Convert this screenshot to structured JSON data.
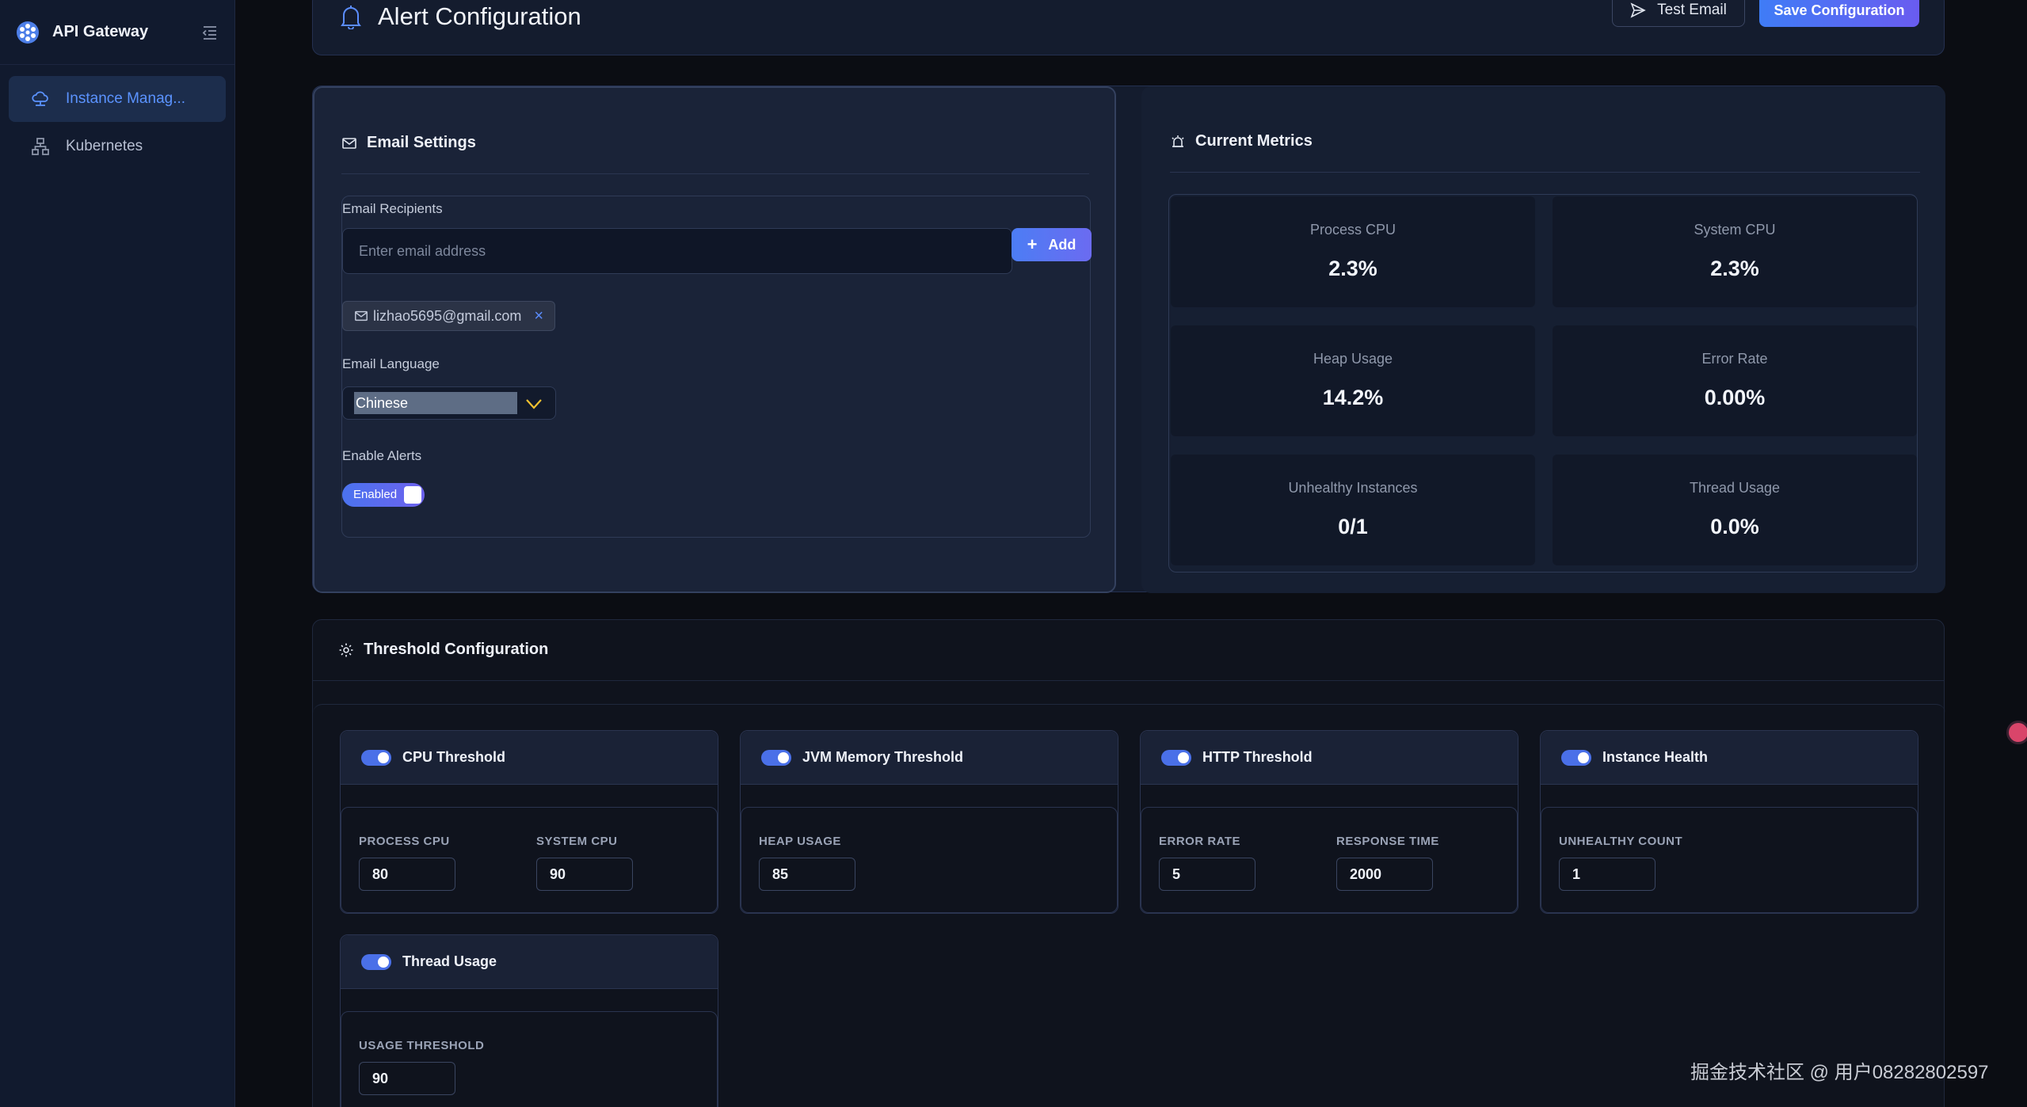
{
  "app": {
    "name": "API Gateway"
  },
  "sidebar": {
    "items": [
      {
        "label": "Instance Manag...",
        "icon": "cloud-network-icon",
        "active": true
      },
      {
        "label": "Kubernetes",
        "icon": "cluster-icon",
        "active": false
      }
    ]
  },
  "header": {
    "title": "Alert Configuration",
    "test_email_label": "Test Email",
    "save_label": "Save Configuration"
  },
  "email_settings": {
    "title": "Email Settings",
    "recipients_label": "Email Recipients",
    "input_placeholder": "Enter email address",
    "input_value": "",
    "add_label": "Add",
    "recipients": [
      "lizhao5695@gmail.com"
    ],
    "remove_symbol": "×",
    "language_label": "Email Language",
    "language_value": "Chinese",
    "alerts_label": "Enable Alerts",
    "alerts_toggle_text": "Enabled",
    "alerts_enabled": true
  },
  "metrics": {
    "title": "Current Metrics",
    "items": [
      {
        "label": "Process CPU",
        "value": "2.3%"
      },
      {
        "label": "System CPU",
        "value": "2.3%"
      },
      {
        "label": "Heap Usage",
        "value": "14.2%"
      },
      {
        "label": "Error Rate",
        "value": "0.00%"
      },
      {
        "label": "Unhealthy Instances",
        "value": "0/1"
      },
      {
        "label": "Thread Usage",
        "value": "0.0%"
      }
    ]
  },
  "thresholds": {
    "title": "Threshold Configuration",
    "cards": [
      {
        "title": "CPU Threshold",
        "enabled": true,
        "fields": [
          {
            "label": "PROCESS CPU",
            "value": "80"
          },
          {
            "label": "SYSTEM CPU",
            "value": "90"
          }
        ]
      },
      {
        "title": "JVM Memory Threshold",
        "enabled": true,
        "fields": [
          {
            "label": "HEAP USAGE",
            "value": "85"
          }
        ]
      },
      {
        "title": "HTTP Threshold",
        "enabled": true,
        "fields": [
          {
            "label": "ERROR RATE",
            "value": "5"
          },
          {
            "label": "RESPONSE TIME",
            "value": "2000"
          }
        ]
      },
      {
        "title": "Instance Health",
        "enabled": true,
        "fields": [
          {
            "label": "UNHEALTHY COUNT",
            "value": "1"
          }
        ]
      },
      {
        "title": "Thread Usage",
        "enabled": true,
        "fields": [
          {
            "label": "USAGE THRESHOLD",
            "value": "90"
          }
        ]
      }
    ]
  },
  "watermark": "掘金技术社区 @ 用户08282802597",
  "colors": {
    "accent": "#5b8dff",
    "primary_gradient_start": "#3f7cf6",
    "primary_gradient_end": "#6a5cf0",
    "background": "#0b0d13"
  }
}
